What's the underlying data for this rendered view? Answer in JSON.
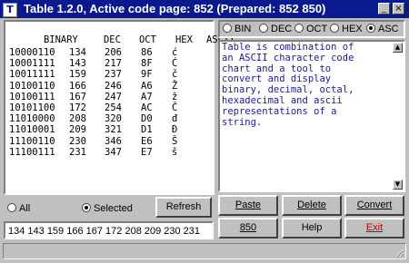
{
  "window": {
    "title": "Table 1.2.0,  Active code page: 852 (Prepared:  852  850)",
    "app_icon": "T",
    "controls": {
      "minimize": "_",
      "close": "×"
    }
  },
  "table": {
    "headers": [
      "BINARY",
      "DEC",
      "OCT",
      "HEX",
      "ASCII"
    ],
    "rows": [
      [
        "10000110",
        "134",
        "206",
        "86",
        "ć"
      ],
      [
        "10001111",
        "143",
        "217",
        "8F",
        "Ć"
      ],
      [
        "10011111",
        "159",
        "237",
        "9F",
        "č"
      ],
      [
        "10100110",
        "166",
        "246",
        "A6",
        "Ž"
      ],
      [
        "10100111",
        "167",
        "247",
        "A7",
        "ž"
      ],
      [
        "10101100",
        "172",
        "254",
        "AC",
        "Č"
      ],
      [
        "11010000",
        "208",
        "320",
        "D0",
        "đ"
      ],
      [
        "11010001",
        "209",
        "321",
        "D1",
        "Đ"
      ],
      [
        "11100110",
        "230",
        "346",
        "E6",
        "Š"
      ],
      [
        "11100111",
        "231",
        "347",
        "E7",
        "š"
      ]
    ]
  },
  "selection": {
    "options": [
      {
        "label": "All",
        "selected": false
      },
      {
        "label": "Selected",
        "selected": true
      }
    ],
    "refresh_label": "Refresh"
  },
  "codes_field": {
    "value": "134 143 159 166 167 172 208 209 230 231"
  },
  "mode": {
    "options": [
      {
        "label": "BIN",
        "selected": false
      },
      {
        "label": "DEC",
        "selected": false
      },
      {
        "label": "OCT",
        "selected": false
      },
      {
        "label": "HEX",
        "selected": false
      },
      {
        "label": "ASC",
        "selected": true
      }
    ]
  },
  "description": {
    "lines": [
      "Table is combination of",
      "an ASCII character code",
      "chart and a tool to",
      "convert and display",
      "binary, decimal, octal,",
      "hexadecimal and ascii",
      "representations of a",
      "string."
    ]
  },
  "buttons": {
    "paste": "Paste",
    "delete": "Delete",
    "convert": "Convert",
    "cp850": "850",
    "help": "Help",
    "exit": "Exit"
  },
  "colors": {
    "title_bar": "#0a1a8c",
    "description_text": "#1a1aa0",
    "exit_text": "#c00000"
  }
}
